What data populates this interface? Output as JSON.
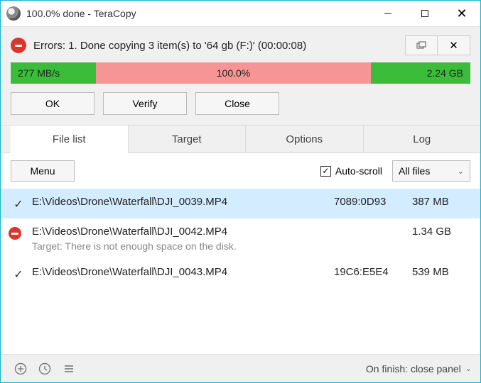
{
  "window": {
    "title": "100.0% done - TeraCopy"
  },
  "status": {
    "message": "Errors: 1. Done copying 3 item(s) to '64 gb (F:)' (00:00:08)"
  },
  "progress": {
    "speed": "277 MB/s",
    "percent": "100.0%",
    "total": "2.24 GB"
  },
  "actions": {
    "ok": "OK",
    "verify": "Verify",
    "close": "Close"
  },
  "tabs": {
    "filelist": "File list",
    "target": "Target",
    "options": "Options",
    "log": "Log"
  },
  "toolbar": {
    "menu": "Menu",
    "autoscroll": "Auto-scroll",
    "filter": "All files"
  },
  "files": [
    {
      "path": "E:\\Videos\\Drone\\Waterfall\\DJI_0039.MP4",
      "hash": "7089:0D93",
      "size": "387 MB",
      "status": "ok"
    },
    {
      "path": "E:\\Videos\\Drone\\Waterfall\\DJI_0042.MP4",
      "hash": "",
      "size": "1.34 GB",
      "status": "error",
      "error": "Target: There is not enough space on the disk."
    },
    {
      "path": "E:\\Videos\\Drone\\Waterfall\\DJI_0043.MP4",
      "hash": "19C6:E5E4",
      "size": "539 MB",
      "status": "ok"
    }
  ],
  "footer": {
    "on_finish_label": "On finish: close panel"
  }
}
